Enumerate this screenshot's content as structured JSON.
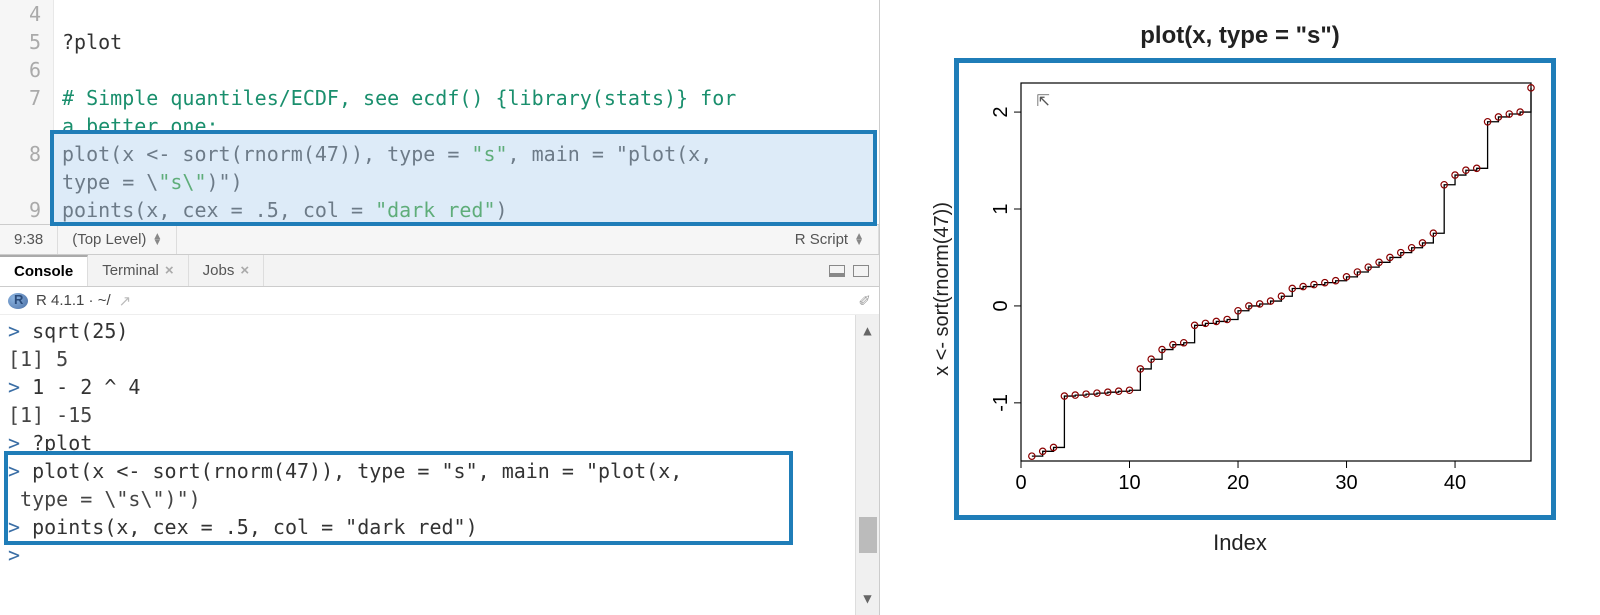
{
  "editor": {
    "first_line_no": 4,
    "lines": [
      {
        "no": 4,
        "text": ""
      },
      {
        "no": 5,
        "text": "?plot"
      },
      {
        "no": 6,
        "text": ""
      },
      {
        "no": 7,
        "text": "# Simple quantiles/ECDF, see ecdf() {library(stats)} for",
        "cls": "cmt"
      },
      {
        "no": null,
        "text": "a better one:",
        "cls": "cmt"
      },
      {
        "no": 8,
        "text": "plot(x <- sort(rnorm(47)), type = \"s\", main = \"plot(x, "
      },
      {
        "no": null,
        "text": "type = \\\"s\\\")\")"
      },
      {
        "no": 9,
        "text": "points(x, cex = .5, col = \"dark red\")"
      }
    ],
    "cursor_pos": "9:38",
    "scope": "(Top Level)",
    "lang": "R Script"
  },
  "tabs": {
    "items": [
      {
        "label": "Console",
        "closable": false,
        "active": true
      },
      {
        "label": "Terminal",
        "closable": true,
        "active": false
      },
      {
        "label": "Jobs",
        "closable": true,
        "active": false
      }
    ]
  },
  "console_header": {
    "version": "R 4.1.1 · ~/"
  },
  "console": {
    "lines": [
      {
        "prompt": ">",
        "text": " sqrt(25)"
      },
      {
        "prompt": "",
        "text": "[1] 5"
      },
      {
        "prompt": ">",
        "text": " 1 - 2 ^ 4"
      },
      {
        "prompt": "",
        "text": "[1] -15"
      },
      {
        "prompt": ">",
        "text": " ?plot"
      },
      {
        "prompt": ">",
        "text": " plot(x <- sort(rnorm(47)), type = \"s\", main = \"plot(x,"
      },
      {
        "prompt": "",
        "text": " type = \\\"s\\\")\")"
      },
      {
        "prompt": ">",
        "text": " points(x, cex = .5, col = \"dark red\")"
      },
      {
        "prompt": ">",
        "text": " "
      }
    ]
  },
  "chart_data": {
    "type": "step",
    "title": "plot(x, type = \"s\")",
    "xlabel": "Index",
    "ylabel": "x <- sort(rnorm(47))",
    "xlim": [
      0,
      47
    ],
    "ylim": [
      -1.6,
      2.3
    ],
    "xticks": [
      0,
      10,
      20,
      30,
      40
    ],
    "yticks": [
      -1,
      0,
      1,
      2
    ],
    "values": [
      -1.55,
      -1.5,
      -1.46,
      -0.93,
      -0.92,
      -0.91,
      -0.9,
      -0.89,
      -0.88,
      -0.87,
      -0.65,
      -0.55,
      -0.45,
      -0.4,
      -0.38,
      -0.2,
      -0.18,
      -0.16,
      -0.14,
      -0.05,
      0.0,
      0.02,
      0.05,
      0.1,
      0.18,
      0.2,
      0.22,
      0.24,
      0.26,
      0.3,
      0.35,
      0.4,
      0.45,
      0.5,
      0.55,
      0.6,
      0.65,
      0.75,
      1.25,
      1.35,
      1.4,
      1.42,
      1.9,
      1.95,
      1.98,
      2.0,
      2.25
    ],
    "point_color": "#8B0000"
  }
}
